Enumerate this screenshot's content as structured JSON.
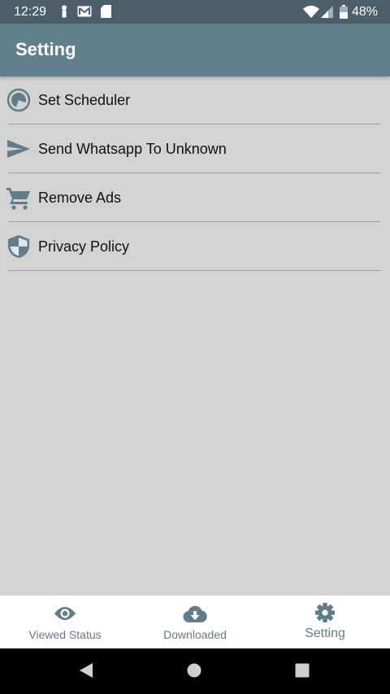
{
  "status_bar": {
    "time": "12:29",
    "battery_percent": "48%",
    "icons": [
      "person-icon",
      "mail-icon",
      "sd-card-icon",
      "wifi-icon",
      "signal-icon",
      "battery-icon"
    ]
  },
  "app_bar": {
    "title": "Setting"
  },
  "settings": {
    "items": [
      {
        "label": "Set Scheduler",
        "icon": "clock-icon"
      },
      {
        "label": "Send Whatsapp To Unknown",
        "icon": "send-icon"
      },
      {
        "label": "Remove Ads",
        "icon": "cart-icon"
      },
      {
        "label": "Privacy Policy",
        "icon": "shield-icon"
      }
    ]
  },
  "bottom_nav": {
    "items": [
      {
        "label": "Viewed Status",
        "icon": "eye-icon",
        "active": false
      },
      {
        "label": "Downloaded",
        "icon": "cloud-download-icon",
        "active": false
      },
      {
        "label": "Setting",
        "icon": "gear-icon",
        "active": true
      }
    ]
  },
  "colors": {
    "status_bar": "#4b5e69",
    "app_bar": "#627f8c",
    "background": "#d3d3d3",
    "icon_tint": "#607d8b",
    "divider": "#8aa1ad"
  }
}
